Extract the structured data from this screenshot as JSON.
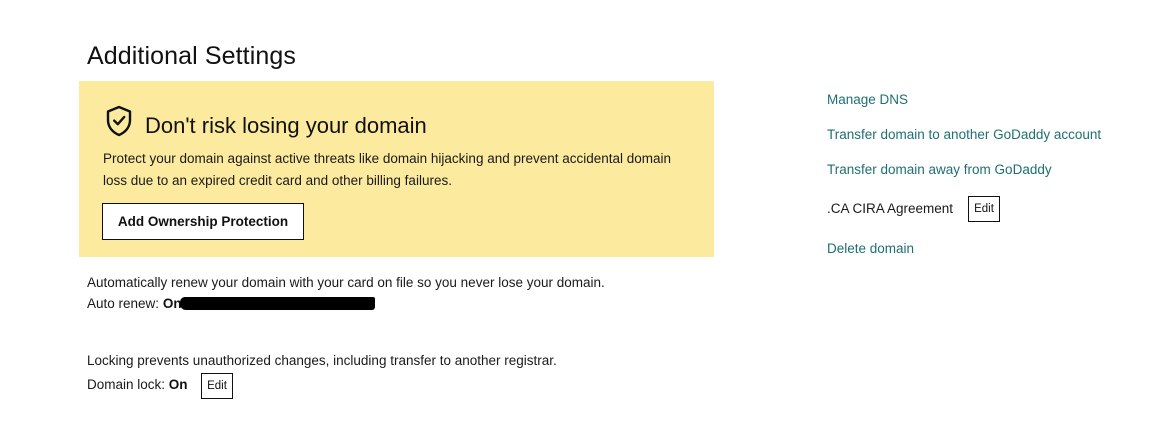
{
  "page": {
    "title": "Additional Settings"
  },
  "promo": {
    "icon": "shield-check-icon",
    "title": "Don't risk losing your domain",
    "description": "Protect your domain against active threats like domain hijacking and prevent accidental domain loss due to an expired credit card and other billing failures.",
    "button_label": "Add Ownership Protection",
    "background_color": "#fcea9e"
  },
  "auto_renew": {
    "description": "Automatically renew your domain with your card on file so you never lose your domain.",
    "label": "Auto renew:",
    "value": "On"
  },
  "domain_lock": {
    "description": "Locking prevents unauthorized changes, including transfer to another registrar.",
    "label": "Domain lock:",
    "value": "On",
    "edit_label": "Edit"
  },
  "side_links": {
    "manage_dns": "Manage DNS",
    "transfer_to_account": "Transfer domain to another GoDaddy account",
    "transfer_away": "Transfer domain away from GoDaddy",
    "cira_label": ".CA CIRA Agreement",
    "cira_edit_label": "Edit",
    "delete_domain": "Delete domain",
    "link_color": "#1f6f73"
  }
}
